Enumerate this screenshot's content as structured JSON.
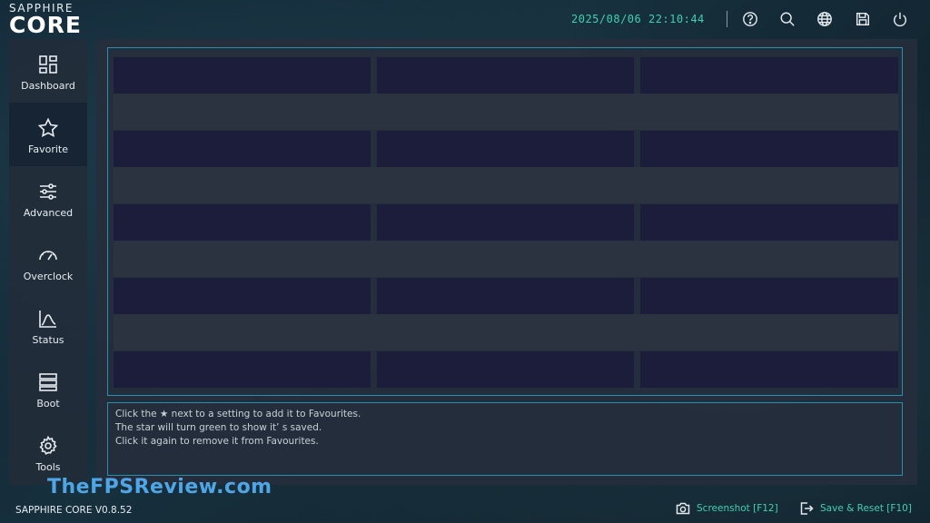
{
  "header": {
    "brand_top": "SAPPHIRE",
    "brand_main": "CORE",
    "datetime": "2025/08/06 22:10:44",
    "icons": [
      "help-icon",
      "search-icon",
      "globe-icon",
      "save-icon",
      "power-icon"
    ]
  },
  "sidebar": {
    "items": [
      {
        "label": "Dashboard",
        "icon": "dashboard-icon",
        "active": false
      },
      {
        "label": "Favorite",
        "icon": "star-icon",
        "active": true
      },
      {
        "label": "Advanced",
        "icon": "sliders-icon",
        "active": false
      },
      {
        "label": "Overclock",
        "icon": "gauge-icon",
        "active": false
      },
      {
        "label": "Status",
        "icon": "chart-icon",
        "active": false
      },
      {
        "label": "Boot",
        "icon": "server-icon",
        "active": false
      },
      {
        "label": "Tools",
        "icon": "gear-icon",
        "active": false
      }
    ]
  },
  "info": {
    "lines": [
      "Click the ★ next to a setting to add it to Favourites.",
      "The star will turn green to show it’ s saved.",
      "Click it again to remove it from Favourites."
    ]
  },
  "footer": {
    "version": "SAPPHIRE CORE V0.8.52",
    "watermark": "TheFPSReview.com",
    "screenshot_label": "Screenshot [F12]",
    "save_reset_label": "Save & Reset [F10]"
  },
  "colors": {
    "accent": "#3fd0b0",
    "frame": "#2a8fa8",
    "watermark": "#4ea6e6"
  }
}
